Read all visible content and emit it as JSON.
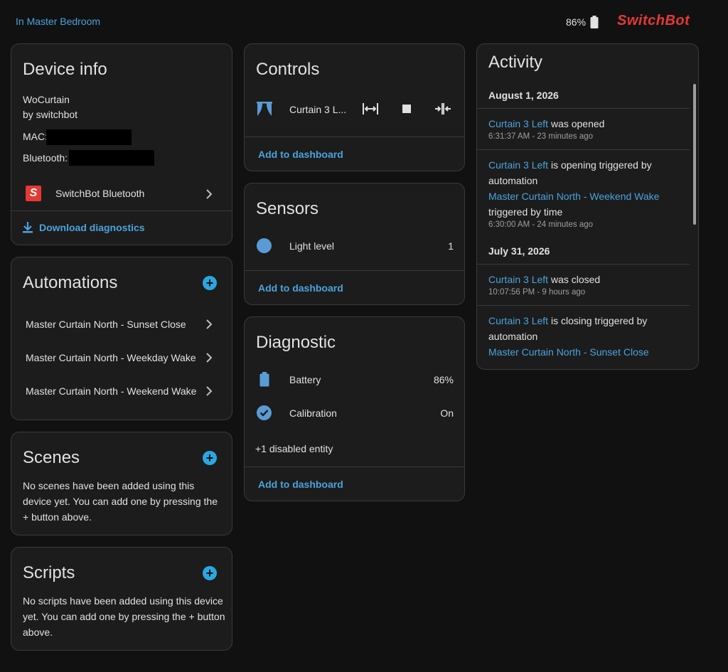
{
  "header": {
    "area": "In Master Bedroom",
    "battery": "86%",
    "brand": "SwitchBot"
  },
  "device_info": {
    "title": "Device info",
    "model": "WoCurtain",
    "manufacturer": "by switchbot",
    "mac_label": "MAC:",
    "bt_label": "Bluetooth:",
    "integration": "SwitchBot Bluetooth",
    "download": "Download diagnostics"
  },
  "automations": {
    "title": "Automations",
    "items": [
      "Master Curtain North - Sunset Close",
      "Master Curtain North - Weekday Wake",
      "Master Curtain North - Weekend Wake"
    ]
  },
  "scenes": {
    "title": "Scenes",
    "empty": "No scenes have been added using this device yet. You can add one by pressing the + button above."
  },
  "scripts": {
    "title": "Scripts",
    "empty": "No scripts have been added using this device yet. You can add one by pressing the + button above."
  },
  "controls": {
    "title": "Controls",
    "entity": "Curtain 3 L...",
    "add": "Add to dashboard"
  },
  "sensors": {
    "title": "Sensors",
    "items": [
      {
        "label": "Light level",
        "value": "1"
      }
    ],
    "add": "Add to dashboard"
  },
  "diagnostic": {
    "title": "Diagnostic",
    "items": [
      {
        "label": "Battery",
        "value": "86%"
      },
      {
        "label": "Calibration",
        "value": "On"
      }
    ],
    "disabled": "+1 disabled entity",
    "add": "Add to dashboard"
  },
  "activity": {
    "title": "Activity",
    "day1": "August 1, 2026",
    "day2": "July 31, 2026",
    "entries": [
      {
        "entity": "Curtain 3 Left",
        "text": " was opened",
        "time": "6:31:37 AM - 23 minutes ago"
      },
      {
        "entity": "Curtain 3 Left",
        "text": " is opening triggered by automation",
        "automation": "Master Curtain North - Weekend Wake",
        "extra": "triggered by time",
        "time": "6:30:00 AM - 24 minutes ago"
      },
      {
        "entity": "Curtain 3 Left",
        "text": " was closed",
        "time": "10:07:56 PM - 9 hours ago"
      },
      {
        "entity": "Curtain 3 Left",
        "text": " is closing triggered by automation",
        "automation": "Master Curtain North - Sunset Close"
      }
    ]
  },
  "colors": {
    "accent": "#4aa3dc",
    "brand": "#e53935",
    "icon_blue": "#5b9bd5"
  }
}
